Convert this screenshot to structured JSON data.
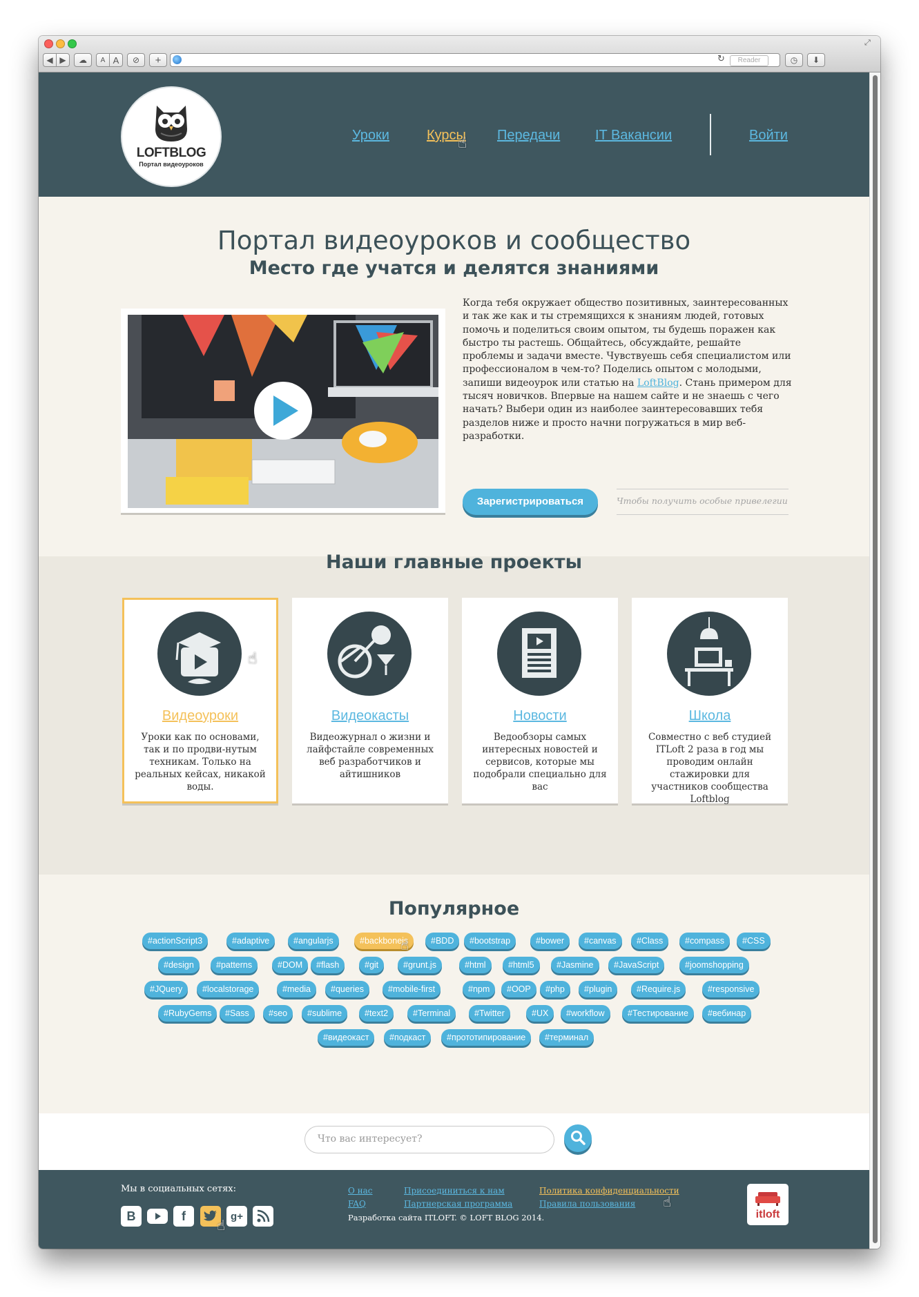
{
  "browser": {
    "reader_label": "Reader",
    "font_small": "A",
    "font_large": "A",
    "add_label": "+"
  },
  "header": {
    "logo_title": "LOFTBLOG",
    "logo_subtitle": "Портал видеоуроков",
    "nav": [
      {
        "label": "Уроки",
        "active": false
      },
      {
        "label": "Курсы",
        "active": true
      },
      {
        "label": "Передачи",
        "active": false
      },
      {
        "label": "IT Вакансии",
        "active": false
      }
    ],
    "login_label": "Войти"
  },
  "hero": {
    "title": "Портал видеоуроков и сообщество",
    "subtitle": "Место где учатся и делятся знаниями",
    "text_before_link": "Когда тебя окружает общество позитивных, заинтересованных и так же как и ты стремящихся к знаниям людей, готовых помочь и поделиться своим опытом, ты будешь поражен как быстро ты растешь. Общайтесь, обсуждайте, решайте проблемы и задачи вместе. Чувствуешь себя специалистом или профессионалом в чем-то? Поделись опытом с молодыми, запиши видеоурок или статью на ",
    "link_text": "LoftBlog",
    "text_after_link": ". Стань примером для тысяч новичков. Впервые на нашем сайте и не знаешь с чего начать? Выбери один из наиболее заинтересовавших тебя разделов ниже и просто начни погружаться в мир веб-разработки.",
    "register_label": "Зарегистрироваться",
    "register_hint": "Чтобы получить особые привелегии"
  },
  "projects": {
    "title": "Наши главные проекты",
    "cards": [
      {
        "title": "Видеоуроки",
        "description": "Уроки как по основами, так и по продви-нутым техникам. Только на реальных кейсах, никакой воды.",
        "icon": "graduation-video-icon",
        "highlighted": true
      },
      {
        "title": "Видеокасты",
        "description": "Видеожурнал о жизни и лайфстайле современных веб разработчиков и айтишников",
        "icon": "lifestyle-icon",
        "highlighted": false
      },
      {
        "title": "Новости",
        "description": "Ведообзоры самых интересных новостей и сервисов, которые мы подобрали специально для вас",
        "icon": "news-icon",
        "highlighted": false
      },
      {
        "title": "Школа",
        "description": "Совместно с веб студией ITLoft 2 раза в год мы проводим онлайн стажировки для участников сообщества Loftblog",
        "icon": "school-desk-icon",
        "highlighted": false
      }
    ]
  },
  "popular": {
    "title": "Популярное",
    "rows": [
      [
        "#actionScript3",
        "#adaptive",
        "#angularjs",
        "#backbonejs",
        "#BDD",
        "#bootstrap",
        "#bower",
        "#canvas",
        "#Class",
        "#compass",
        "#CSS"
      ],
      [
        "#design",
        "#patterns",
        "#DOM",
        "#flash",
        "#git",
        "#grunt.js",
        "#html",
        "#html5",
        "#Jasmine",
        "#JavaScript",
        "#joomshopping"
      ],
      [
        "#JQuery",
        "#localstorage",
        "#media",
        "#queries",
        "#mobile-first",
        "#npm",
        "#OOP",
        "#php",
        "#plugin",
        "#Require.js",
        "#responsive"
      ],
      [
        "#RubyGems",
        "#Sass",
        "#seo",
        "#sublime",
        "#text2",
        "#Terminal",
        "#Twitter",
        "#UX",
        "#workflow",
        "#Тестирование",
        "#вебинар"
      ],
      [
        "#видеокаст",
        "#подкаст",
        "#прототипирование",
        "#терминал"
      ]
    ],
    "highlighted_tag": "#backbonejs"
  },
  "search": {
    "placeholder": "Что вас интересует?"
  },
  "footer": {
    "social_title": "Мы в социальных сетях:",
    "social": [
      "vk-icon",
      "youtube-icon",
      "facebook-icon",
      "twitter-icon",
      "googleplus-icon",
      "rss-icon"
    ],
    "links_col1": [
      "О нас",
      "FAQ"
    ],
    "links_col2": [
      "Присоединиться к нам",
      "Партнерская программа"
    ],
    "links_col3": [
      "Политика конфиденциальности",
      "Правила пользования"
    ],
    "copyright": "Разработка сайта ITLOFT. © LOFT BLOG 2014.",
    "partner_logo": "itloft"
  },
  "colors": {
    "header_bg": "#3f575f",
    "accent_blue": "#4fb3dc",
    "accent_yellow": "#f4c15a",
    "hero_bg": "#f6f3ec"
  }
}
